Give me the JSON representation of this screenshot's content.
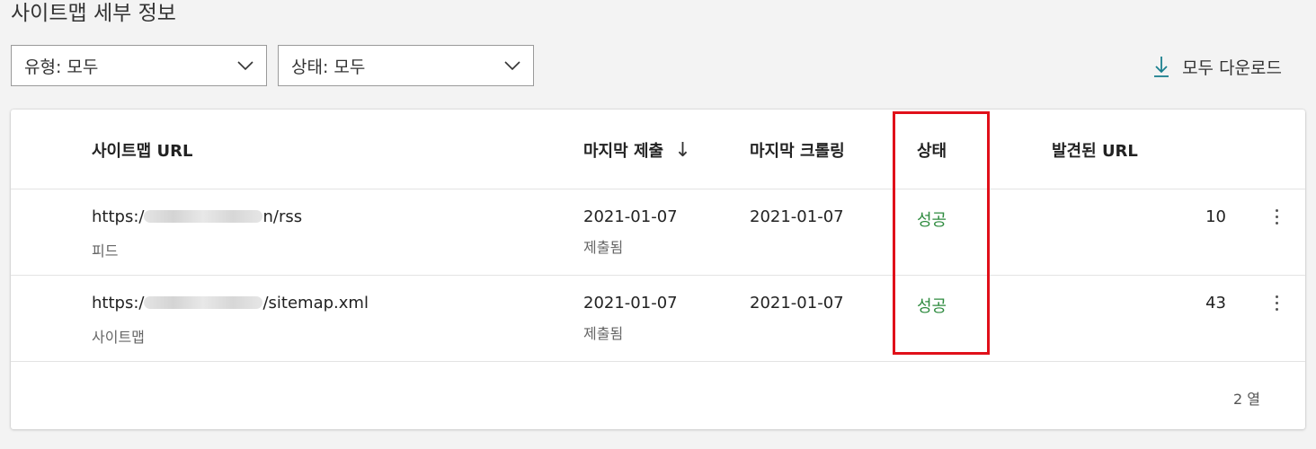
{
  "page": {
    "title": "사이트맵 세부 정보"
  },
  "filters": {
    "type_label": "유형: 모두",
    "status_label": "상태: 모두"
  },
  "toolbar": {
    "download_label": "모두 다운로드"
  },
  "table": {
    "headers": {
      "url": "사이트맵 URL",
      "last_submitted": "마지막 제출",
      "last_submitted_sort_arrow": "↓",
      "last_crawled": "마지막 크롤링",
      "status": "상태",
      "discovered": "발견된 URL"
    },
    "rows": [
      {
        "url_prefix": "https:/",
        "url_suffix": "n/rss",
        "kind": "피드",
        "submitted": "2021-01-07",
        "submitted_sub": "제출됨",
        "crawled": "2021-01-07",
        "status": "성공",
        "discovered": "10"
      },
      {
        "url_prefix": "https:/",
        "url_suffix": "/sitemap.xml",
        "kind": "사이트맵",
        "submitted": "2021-01-07",
        "submitted_sub": "제출됨",
        "crawled": "2021-01-07",
        "status": "성공",
        "discovered": "43"
      }
    ],
    "footer_count": "2 열"
  },
  "colors": {
    "status_success": "#2e8b3f",
    "highlight_box": "#e0101a",
    "download_icon": "#1a7f8e"
  },
  "icons": {
    "filter_chevron": "chevron-down-icon",
    "download": "download-icon",
    "row_menu": "more-vertical-icon"
  }
}
